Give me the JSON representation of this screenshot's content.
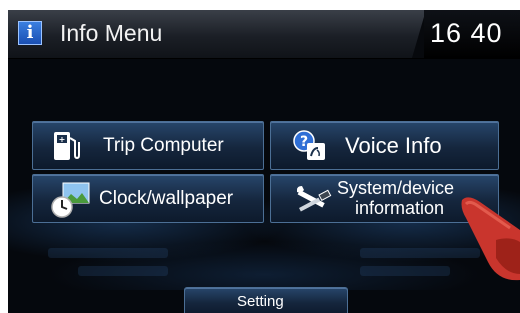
{
  "header": {
    "title": "Info Menu",
    "info_icon_glyph": "i",
    "clock": "16 40"
  },
  "menu": {
    "trip_computer": "Trip Computer",
    "voice_info": "Voice Info",
    "clock_wallpaper": "Clock/wallpaper",
    "system_line1": "System/device",
    "system_line2": "information"
  },
  "footer": {
    "setting": "Setting"
  },
  "icons": {
    "trip": "fuel-pump-icon",
    "voice": "voice-help-icon",
    "clock": "clock-wallpaper-icon",
    "system": "wrench-screwdriver-icon"
  },
  "colors": {
    "button_top": "#27466b",
    "button_border": "#4c6f95",
    "text": "#ffffff"
  }
}
